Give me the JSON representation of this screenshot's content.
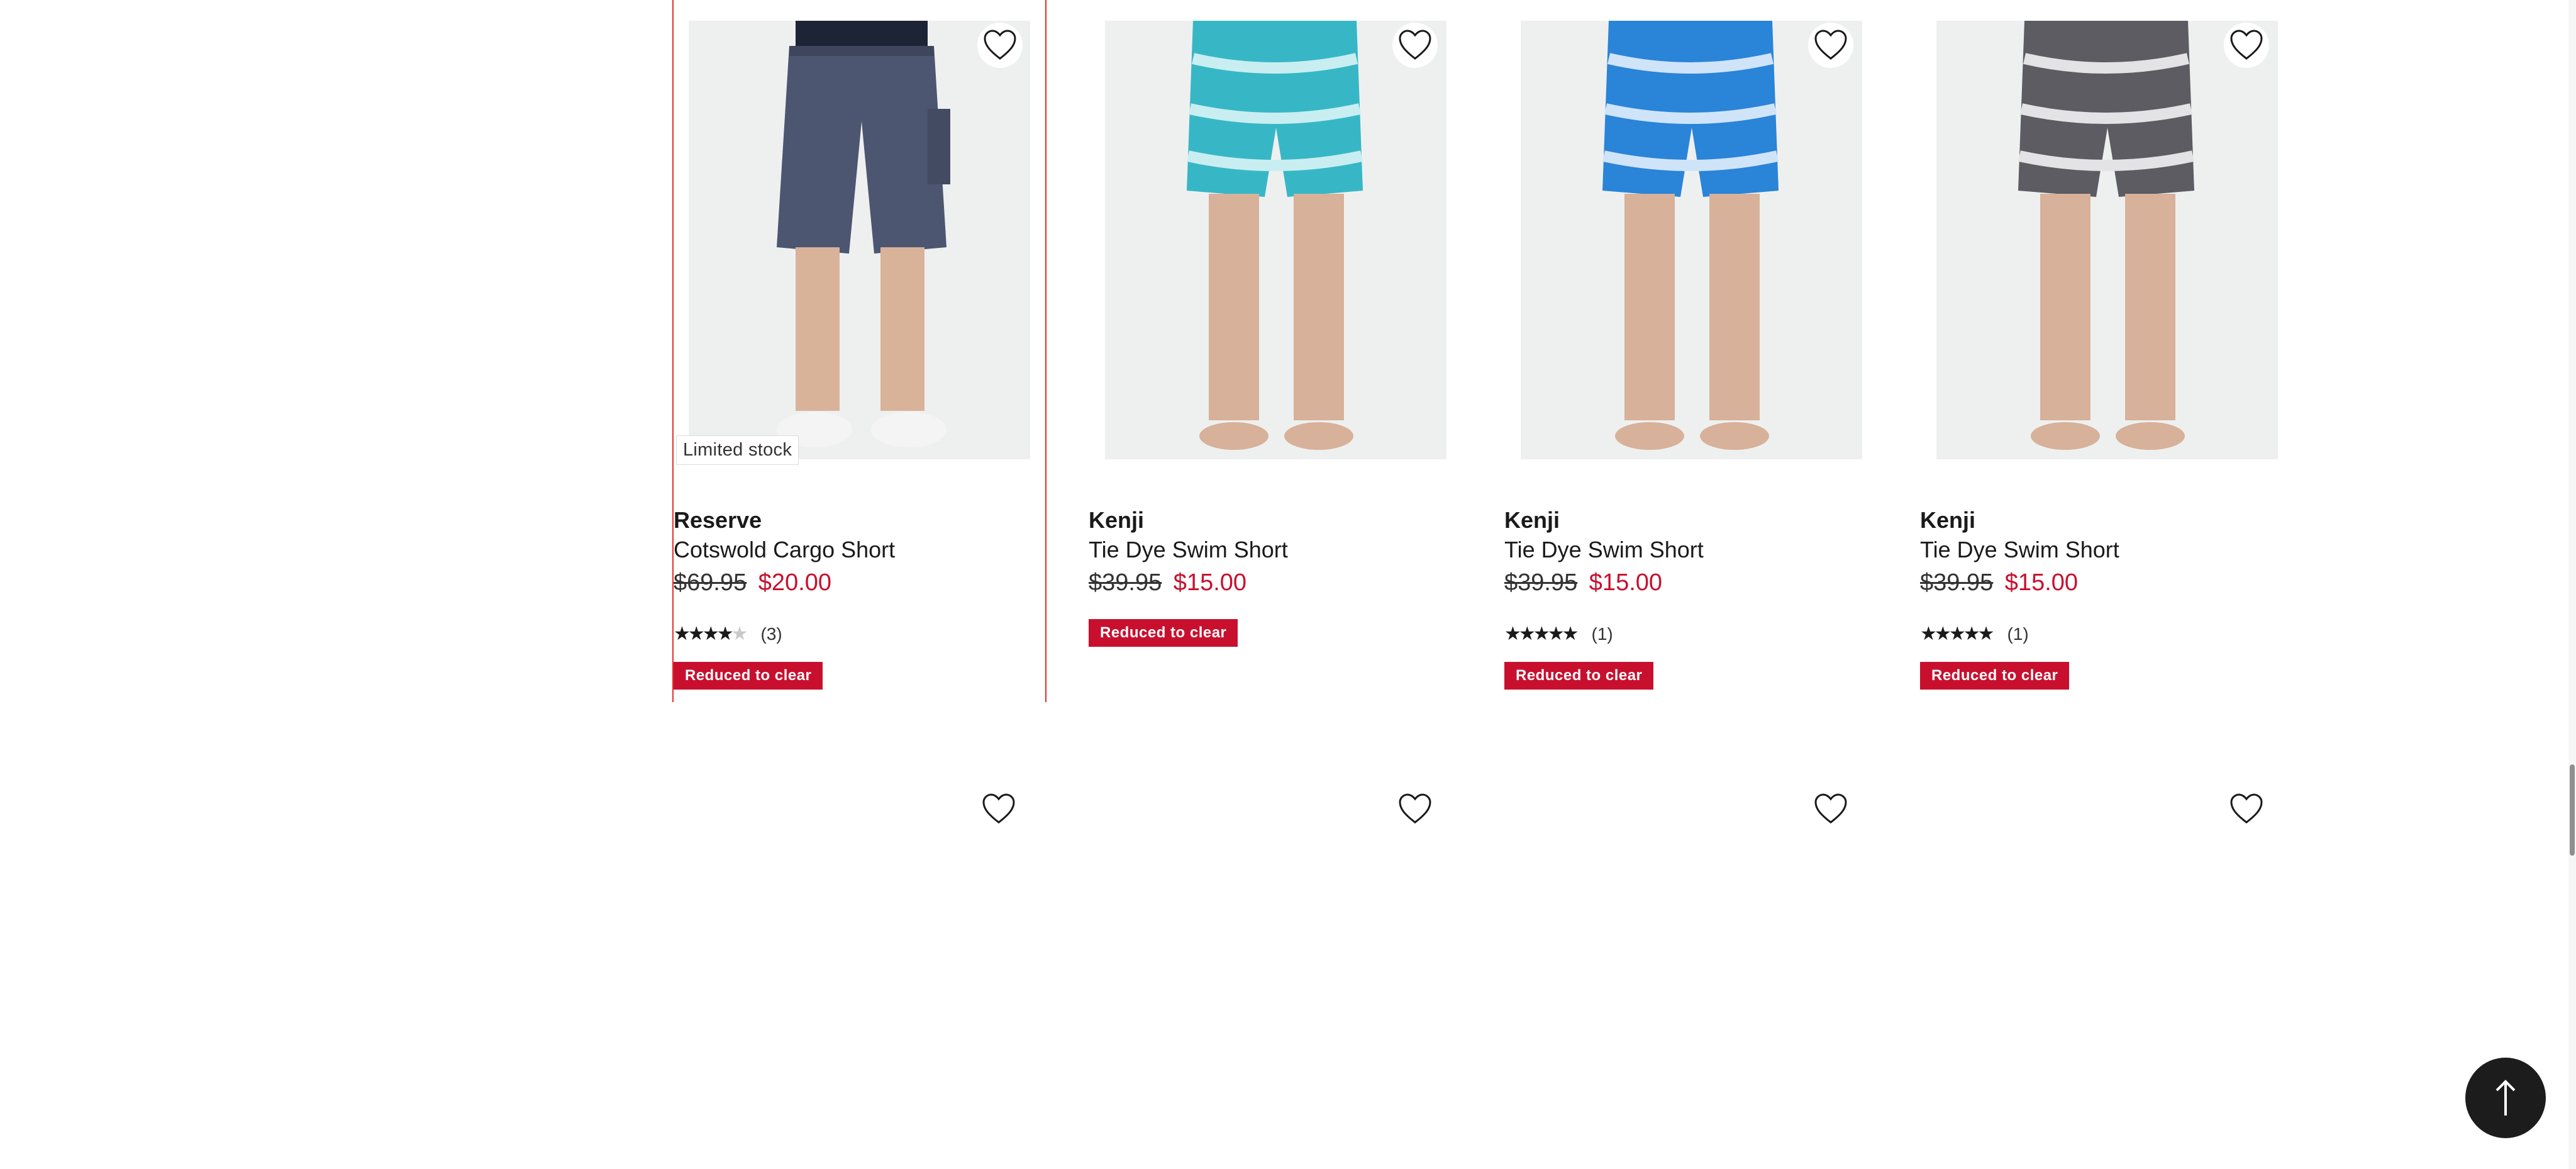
{
  "products": [
    {
      "brand": "Reserve",
      "name": "Cotswold Cargo Short",
      "was": "$69.95",
      "now": "$20.00",
      "limited": "Limited stock",
      "rating": 4,
      "reviews": "(3)",
      "badge": "Reduced to clear",
      "colors": {
        "garment": "#4d5670",
        "skin": "#d9b29a"
      }
    },
    {
      "brand": "Kenji",
      "name": "Tie Dye Swim Short",
      "was": "$39.95",
      "now": "$15.00",
      "badge": "Reduced to clear",
      "colors": {
        "garment": "#37b7c6",
        "skin": "#d7b199"
      }
    },
    {
      "brand": "Kenji",
      "name": "Tie Dye Swim Short",
      "was": "$39.95",
      "now": "$15.00",
      "rating": 5,
      "reviews": "(1)",
      "badge": "Reduced to clear",
      "colors": {
        "garment": "#2a84d8",
        "skin": "#d7b199"
      }
    },
    {
      "brand": "Kenji",
      "name": "Tie Dye Swim Short",
      "was": "$39.95",
      "now": "$15.00",
      "rating": 5,
      "reviews": "(1)",
      "badge": "Reduced to clear",
      "colors": {
        "garment": "#5c5c62",
        "skin": "#d7b199"
      }
    }
  ],
  "icons": {
    "favorite": "heart-outline-icon",
    "back_to_top": "arrow-up-icon"
  },
  "colors": {
    "sale": "#c8102e",
    "selection": "#e4312b"
  }
}
